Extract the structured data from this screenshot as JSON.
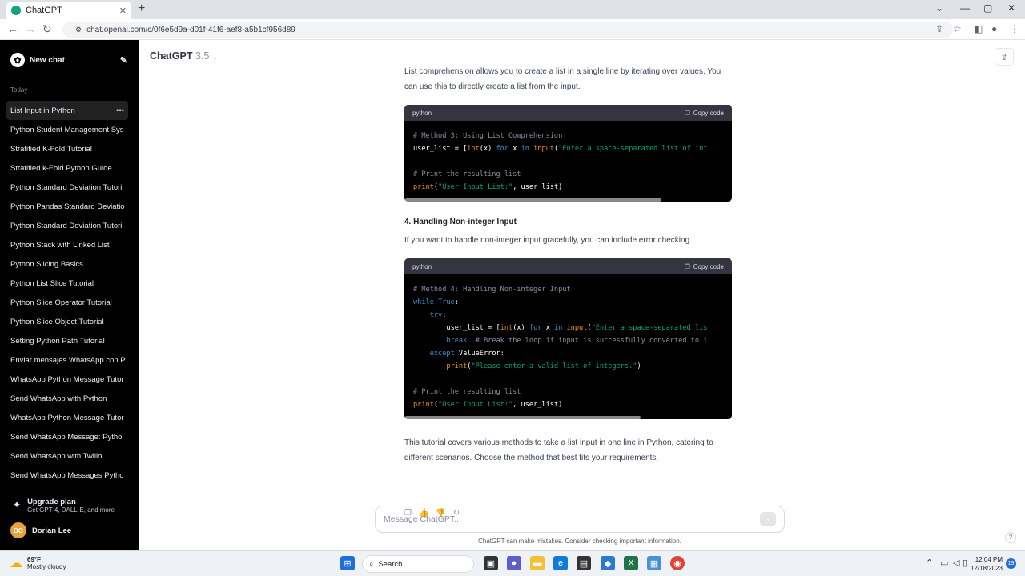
{
  "browser": {
    "tab_title": "ChatGPT",
    "tab_close": "✕",
    "new_tab": "+",
    "url": "chat.openai.com/c/0f6e5d9a-d01f-41f6-aef8-a5b1cf956d89",
    "controls": {
      "collapse": "⌄",
      "minimize": "—",
      "maximize": "▢",
      "close": "✕"
    }
  },
  "sidebar": {
    "new_chat": "New chat",
    "section": "Today",
    "history": [
      "List Input in Python",
      "Python Student Management Sys",
      "Stratified K-Fold Tutorial",
      "Stratified k-Fold Python Guide",
      "Python Standard Deviation Tutori",
      "Python Pandas Standard Deviatio",
      "Python Standard Deviation Tutori",
      "Python Stack with Linked List",
      "Python Slicing Basics",
      "Python List Slice Tutorial",
      "Python Slice Operator Tutorial",
      "Python Slice Object Tutorial",
      "Setting Python Path Tutorial",
      "Enviar mensajes WhatsApp con P",
      "WhatsApp Python Message Tutor",
      "Send WhatsApp with Python",
      "WhatsApp Python Message Tutor",
      "Send WhatsApp Message: Pytho",
      "Send WhatsApp with Twilio.",
      "Send WhatsApp Messages Pytho"
    ],
    "upgrade_title": "Upgrade plan",
    "upgrade_sub": "Get GPT-4, DALL·E, and more",
    "user_initials": "DO",
    "user_name": "Dorian Lee"
  },
  "header": {
    "model": "ChatGPT",
    "version": "3.5"
  },
  "chat": {
    "intro": "List comprehension allows you to create a list in a single line by iterating over values. You can use this to directly create a list from the input.",
    "code_lang": "python",
    "copy_label": "Copy code",
    "code1": [
      [
        [
          "cm",
          "# Method 3: Using List Comprehension"
        ]
      ],
      [
        [
          "",
          "user_list = ["
        ],
        [
          "bi",
          "int"
        ],
        [
          "",
          "(x) "
        ],
        [
          "kw",
          "for"
        ],
        [
          "",
          " x "
        ],
        [
          "kw",
          "in"
        ],
        [
          "",
          " "
        ],
        [
          "bi",
          "input"
        ],
        [
          "",
          "("
        ],
        [
          "st",
          "\"Enter a space-separated list of int"
        ]
      ],
      [],
      [
        [
          "cm",
          "# Print the resulting list"
        ]
      ],
      [
        [
          "bi",
          "print"
        ],
        [
          "",
          "("
        ],
        [
          "st",
          "\"User Input List:\""
        ],
        [
          "",
          ", user_list)"
        ]
      ]
    ],
    "heading4": "4. Handling Non-integer Input",
    "para4": "If you want to handle non-integer input gracefully, you can include error checking.",
    "code2": [
      [
        [
          "cm",
          "# Method 4: Handling Non-integer Input"
        ]
      ],
      [
        [
          "kw",
          "while"
        ],
        [
          "",
          " "
        ],
        [
          "kw",
          "True"
        ],
        [
          "",
          ":"
        ]
      ],
      [
        [
          "",
          "    "
        ],
        [
          "kw",
          "try"
        ],
        [
          "",
          ":"
        ]
      ],
      [
        [
          "",
          "        user_list = ["
        ],
        [
          "bi",
          "int"
        ],
        [
          "",
          "(x) "
        ],
        [
          "kw",
          "for"
        ],
        [
          "",
          " x "
        ],
        [
          "kw",
          "in"
        ],
        [
          "",
          " "
        ],
        [
          "bi",
          "input"
        ],
        [
          "",
          "("
        ],
        [
          "st",
          "\"Enter a space-separated lis"
        ]
      ],
      [
        [
          "",
          "        "
        ],
        [
          "kw",
          "break"
        ],
        [
          "cm",
          "  # Break the loop if input is successfully converted to i"
        ]
      ],
      [
        [
          "",
          "    "
        ],
        [
          "kw",
          "except"
        ],
        [
          "",
          " ValueError:"
        ]
      ],
      [
        [
          "",
          "        "
        ],
        [
          "bi",
          "print"
        ],
        [
          "",
          "("
        ],
        [
          "st",
          "\"Please enter a valid list of integers.\""
        ],
        [
          "",
          ")"
        ]
      ],
      [],
      [
        [
          "cm",
          "# Print the resulting list"
        ]
      ],
      [
        [
          "bi",
          "print"
        ],
        [
          "",
          "("
        ],
        [
          "st",
          "\"User Input List:\""
        ],
        [
          "",
          ", user_list)"
        ]
      ]
    ],
    "conclusion": "This tutorial covers various methods to take a list input in one line in Python, catering to different scenarios. Choose the method that best fits your requirements."
  },
  "composer": {
    "placeholder": "Message ChatGPT...",
    "disclaimer": "ChatGPT can make mistakes. Consider checking important information.",
    "help": "?"
  },
  "taskbar": {
    "temp": "69°F",
    "condition": "Mostly cloudy",
    "search": "Search",
    "time": "12:04 PM",
    "date": "12/18/2023",
    "notifications": "19"
  }
}
